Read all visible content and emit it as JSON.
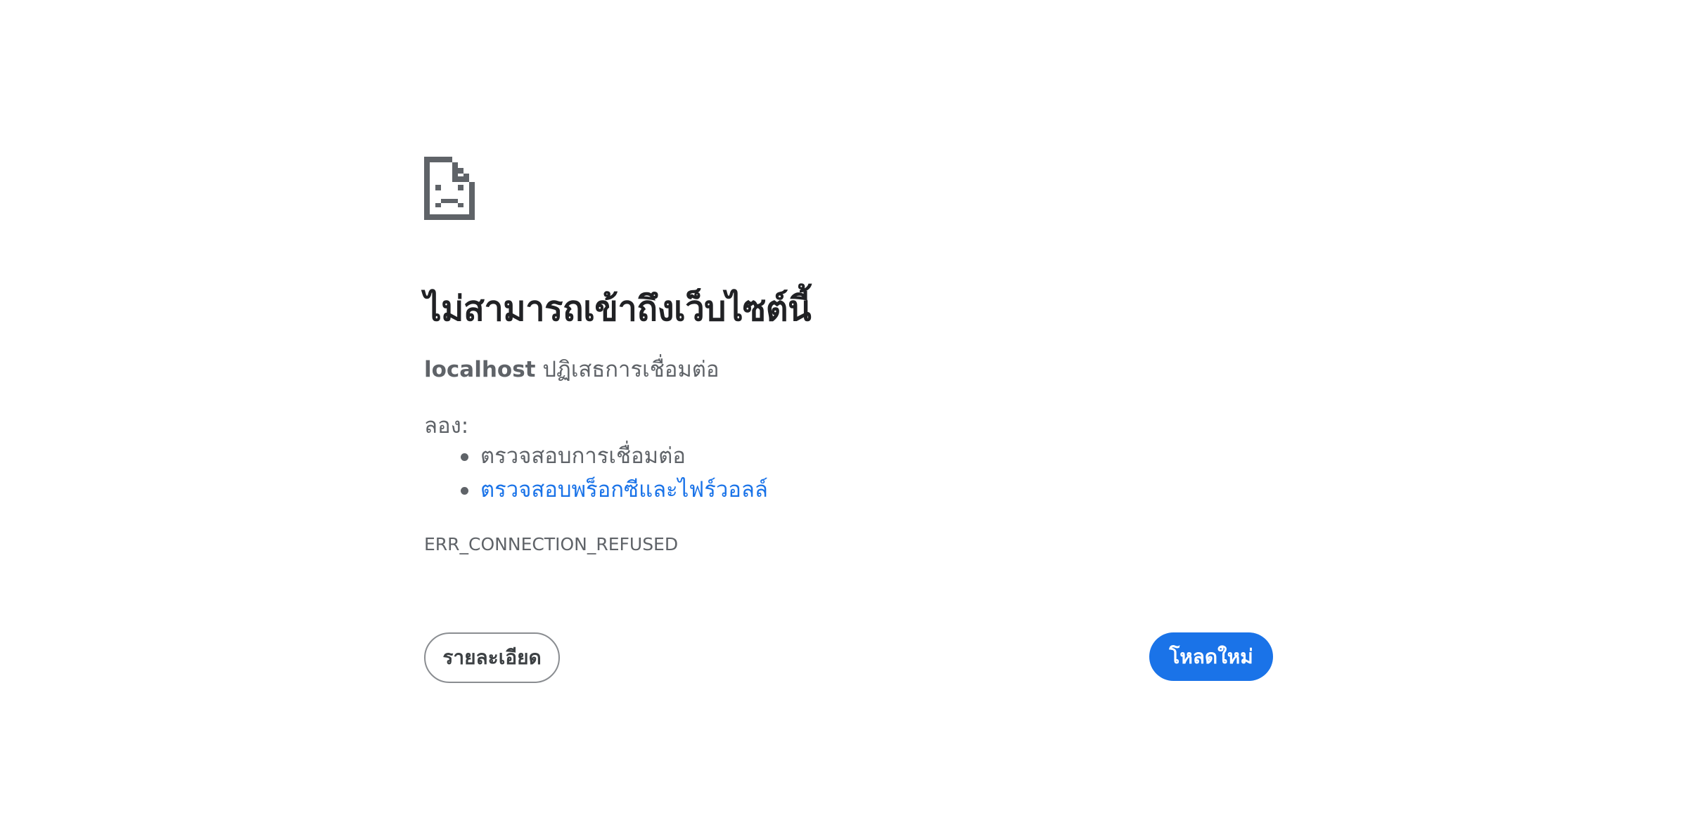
{
  "error": {
    "icon": "sad-document-icon",
    "headline": "ไม่สามารถเข้าถึงเว็บไซต์นี้",
    "host": "localhost",
    "message": "ปฏิเสธการเชื่อมต่อ",
    "try_label": "ลอง:",
    "suggestions": [
      {
        "text": "ตรวจสอบการเชื่อมต่อ",
        "is_link": false
      },
      {
        "text": "ตรวจสอบพร็อกซีและไฟร์วอลล์",
        "is_link": true
      }
    ],
    "code": "ERR_CONNECTION_REFUSED"
  },
  "buttons": {
    "details_label": "รายละเอียด",
    "reload_label": "โหลดใหม่"
  },
  "colors": {
    "text_primary": "#202124",
    "text_secondary": "#5f6368",
    "link": "#1a73e8",
    "button_primary": "#1a73e8"
  }
}
